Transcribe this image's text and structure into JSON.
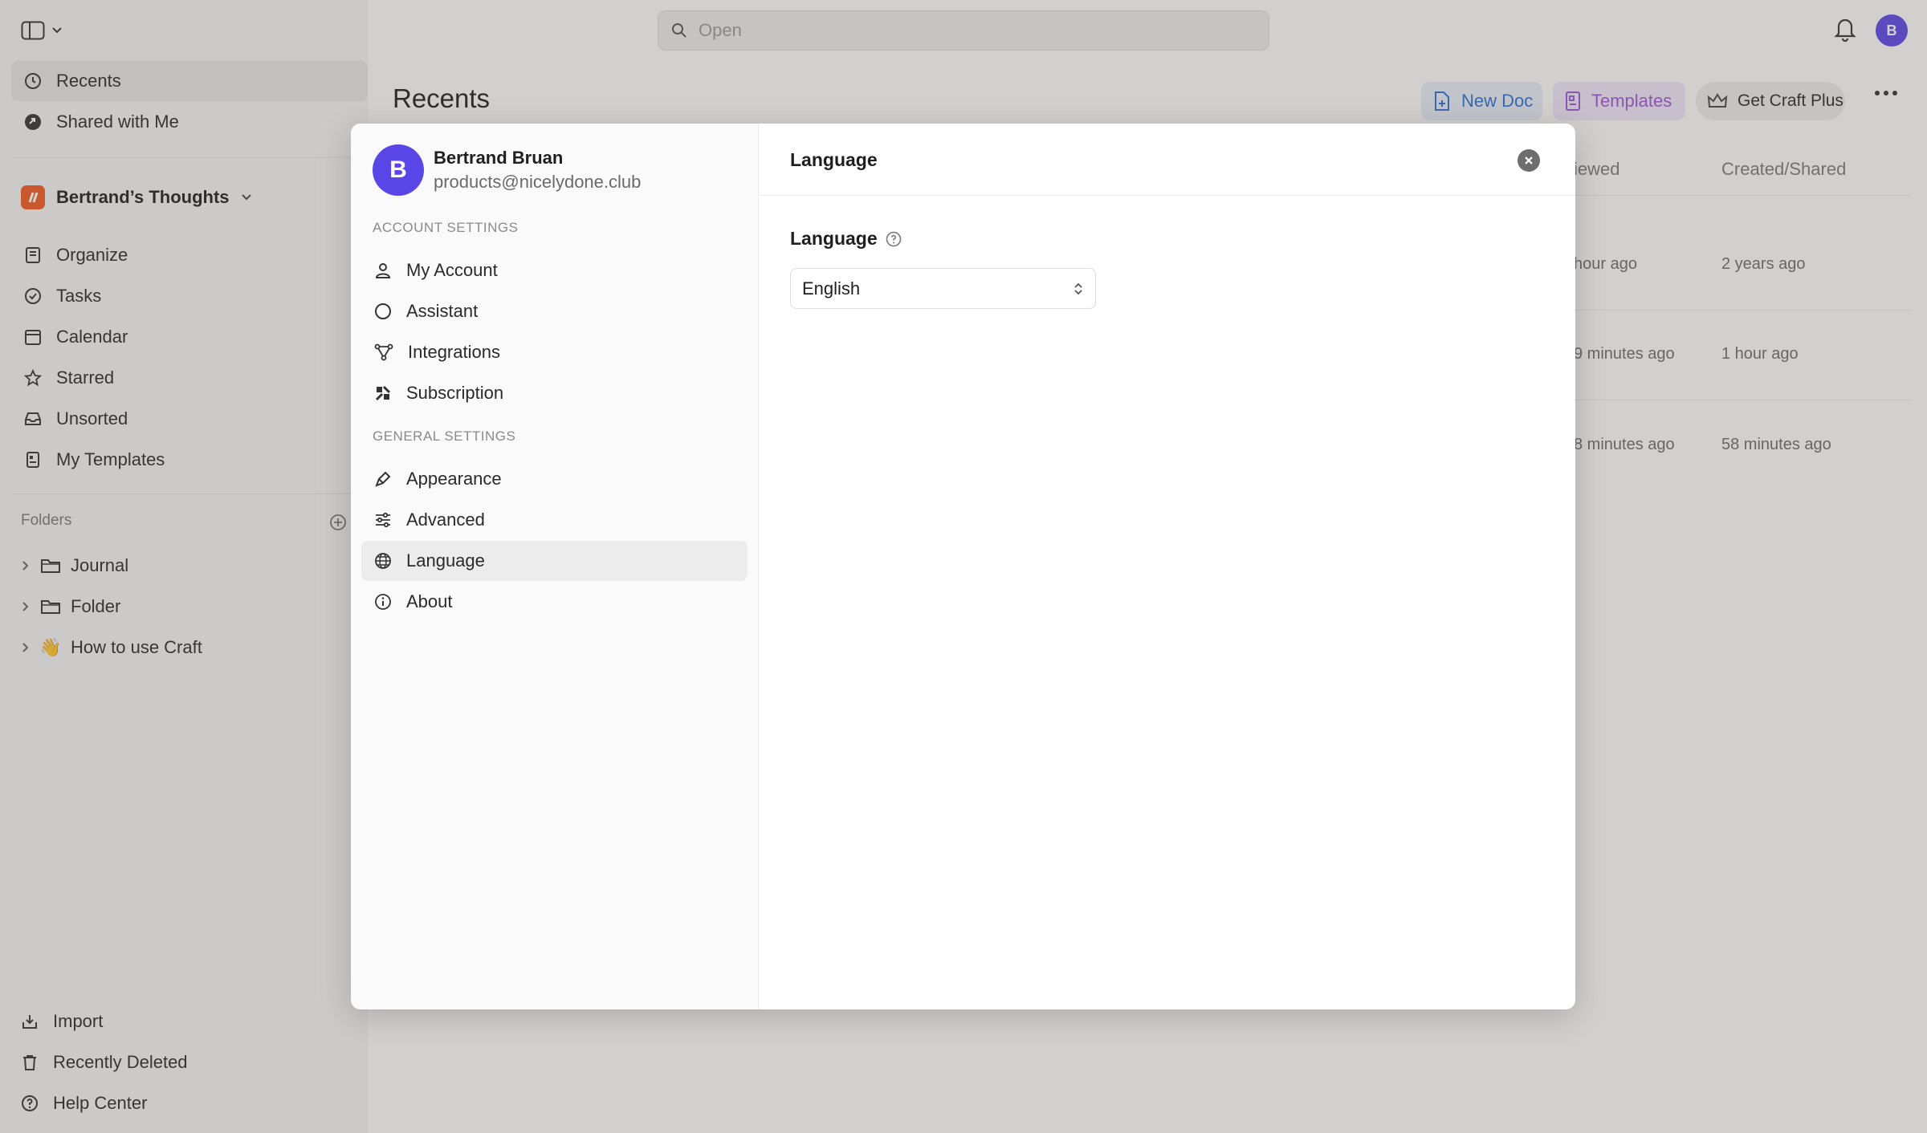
{
  "topbar": {
    "search_placeholder": "Open",
    "avatar_initial": "B"
  },
  "sidebar": {
    "top_items": [
      {
        "label": "Recents",
        "icon": "clock-icon"
      },
      {
        "label": "Shared with Me",
        "icon": "share-icon"
      }
    ],
    "space_name": "Bertrand’s Thoughts",
    "items": [
      {
        "label": "Organize",
        "icon": "organize-icon"
      },
      {
        "label": "Tasks",
        "icon": "check-circle-icon"
      },
      {
        "label": "Calendar",
        "icon": "calendar-icon"
      },
      {
        "label": "Starred",
        "icon": "star-icon"
      },
      {
        "label": "Unsorted",
        "icon": "inbox-icon"
      },
      {
        "label": "My Templates",
        "icon": "template-icon"
      }
    ],
    "folders_title": "Folders",
    "folders": [
      {
        "label": "Journal",
        "icon": "folder-icon"
      },
      {
        "label": "Folder",
        "icon": "folder-icon"
      },
      {
        "label": "How to use Craft",
        "icon": "wave-emoji",
        "emoji": "👋"
      }
    ],
    "bottom_items": [
      {
        "label": "Import",
        "icon": "import-icon"
      },
      {
        "label": "Recently Deleted",
        "icon": "trash-icon"
      },
      {
        "label": "Help Center",
        "icon": "help-icon"
      }
    ]
  },
  "main": {
    "title": "Recents",
    "new_doc": "New Doc",
    "templates": "Templates",
    "get_plus": "Get Craft Plus",
    "columns": [
      "iewed",
      "Created/Shared"
    ],
    "rows": [
      {
        "viewed": "hour ago",
        "created": "2 years ago"
      },
      {
        "viewed": "9 minutes ago",
        "created": "1 hour ago"
      },
      {
        "viewed": "8 minutes ago",
        "created": "58 minutes ago"
      }
    ]
  },
  "settings": {
    "user": {
      "initial": "B",
      "name": "Bertrand Bruan",
      "email": "products@nicelydone.club"
    },
    "account_section": "ACCOUNT SETTINGS",
    "account_items": [
      {
        "label": "My Account",
        "icon": "person-icon"
      },
      {
        "label": "Assistant",
        "icon": "circle-icon"
      },
      {
        "label": "Integrations",
        "icon": "integrations-icon"
      },
      {
        "label": "Subscription",
        "icon": "subscription-icon"
      }
    ],
    "general_section": "GENERAL SETTINGS",
    "general_items": [
      {
        "label": "Appearance",
        "icon": "brush-icon"
      },
      {
        "label": "Advanced",
        "icon": "sliders-icon"
      },
      {
        "label": "Language",
        "icon": "globe-icon",
        "active": true
      },
      {
        "label": "About",
        "icon": "info-icon"
      }
    ],
    "panel": {
      "title": "Language",
      "field_label": "Language",
      "selected_language": "English"
    }
  }
}
